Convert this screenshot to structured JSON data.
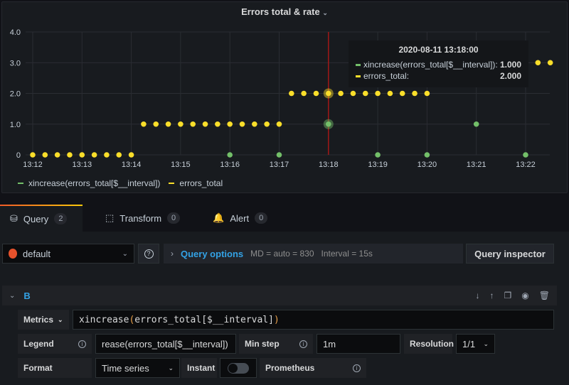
{
  "panel": {
    "title": "Errors total & rate",
    "title_chevron_icon": "chevron-down-icon"
  },
  "chart_data": {
    "type": "scatter",
    "title": "Errors total & rate",
    "ylim": [
      0,
      4
    ],
    "y_ticks": [
      "0",
      "1.0",
      "2.0",
      "3.0",
      "4.0"
    ],
    "x_ticks": [
      "13:12",
      "13:13",
      "13:14",
      "13:15",
      "13:16",
      "13:17",
      "13:18",
      "13:19",
      "13:20",
      "13:21",
      "13:22"
    ],
    "grid": true,
    "legend_placement": "bottom-left",
    "cursor_time": "13:18:00",
    "series": [
      {
        "name": "xincrease(errors_total[$__interval])",
        "color": "#73bf69",
        "x": [
          "13:16:00",
          "13:17:00",
          "13:18:00",
          "13:19:00",
          "13:20:00",
          "13:21:00",
          "13:22:00"
        ],
        "y": [
          0,
          0,
          1,
          0,
          0,
          1,
          0
        ]
      },
      {
        "name": "errors_total",
        "color": "#fade2a",
        "x": [
          "13:12:00",
          "13:12:15",
          "13:12:30",
          "13:12:45",
          "13:13:00",
          "13:13:15",
          "13:13:30",
          "13:13:45",
          "13:14:00",
          "13:14:15",
          "13:14:30",
          "13:14:45",
          "13:15:00",
          "13:15:15",
          "13:15:30",
          "13:15:45",
          "13:16:00",
          "13:16:15",
          "13:16:30",
          "13:16:45",
          "13:17:00",
          "13:17:15",
          "13:17:30",
          "13:17:45",
          "13:18:00",
          "13:18:15",
          "13:18:30",
          "13:18:45",
          "13:19:00",
          "13:19:15",
          "13:19:30",
          "13:19:45",
          "13:20:00",
          "13:22:15",
          "13:22:30"
        ],
        "y": [
          0,
          0,
          0,
          0,
          0,
          0,
          0,
          0,
          0,
          1,
          1,
          1,
          1,
          1,
          1,
          1,
          1,
          1,
          1,
          1,
          1,
          2,
          2,
          2,
          2,
          2,
          2,
          2,
          2,
          2,
          2,
          2,
          2,
          3,
          3
        ]
      }
    ]
  },
  "tooltip": {
    "time": "2020-08-11 13:18:00",
    "rows": [
      {
        "name": "xincrease(errors_total[$__interval]):",
        "value": "1.000",
        "color": "#73bf69"
      },
      {
        "name": "errors_total:",
        "value": "2.000",
        "color": "#fade2a"
      }
    ]
  },
  "legend": [
    {
      "name": "xincrease(errors_total[$__interval])",
      "color": "#73bf69"
    },
    {
      "name": "errors_total",
      "color": "#fade2a"
    }
  ],
  "tabs": [
    {
      "label": "Query",
      "count": "2",
      "icon": "database-icon"
    },
    {
      "label": "Transform",
      "count": "0",
      "icon": "transform-icon"
    },
    {
      "label": "Alert",
      "count": "0",
      "icon": "bell-icon"
    }
  ],
  "toolbar": {
    "datasource": "default",
    "query_options_label": "Query options",
    "md": "MD = auto = 830",
    "interval": "Interval = 15s",
    "query_inspector": "Query inspector"
  },
  "query": {
    "ref": "B",
    "metrics_label": "Metrics",
    "metrics_fn": "xincrease",
    "metrics_open": "(",
    "metrics_body": "errors_total[$__interval]",
    "metrics_close": ")",
    "legend_label": "Legend",
    "legend_value": "rease(errors_total[$__interval])",
    "min_step_label": "Min step",
    "min_step_value": "1m",
    "resolution_label": "Resolution",
    "resolution_value": "1/1",
    "format_label": "Format",
    "format_value": "Time series",
    "instant_label": "Instant",
    "instant_on": false,
    "prometheus_label": "Prometheus"
  }
}
